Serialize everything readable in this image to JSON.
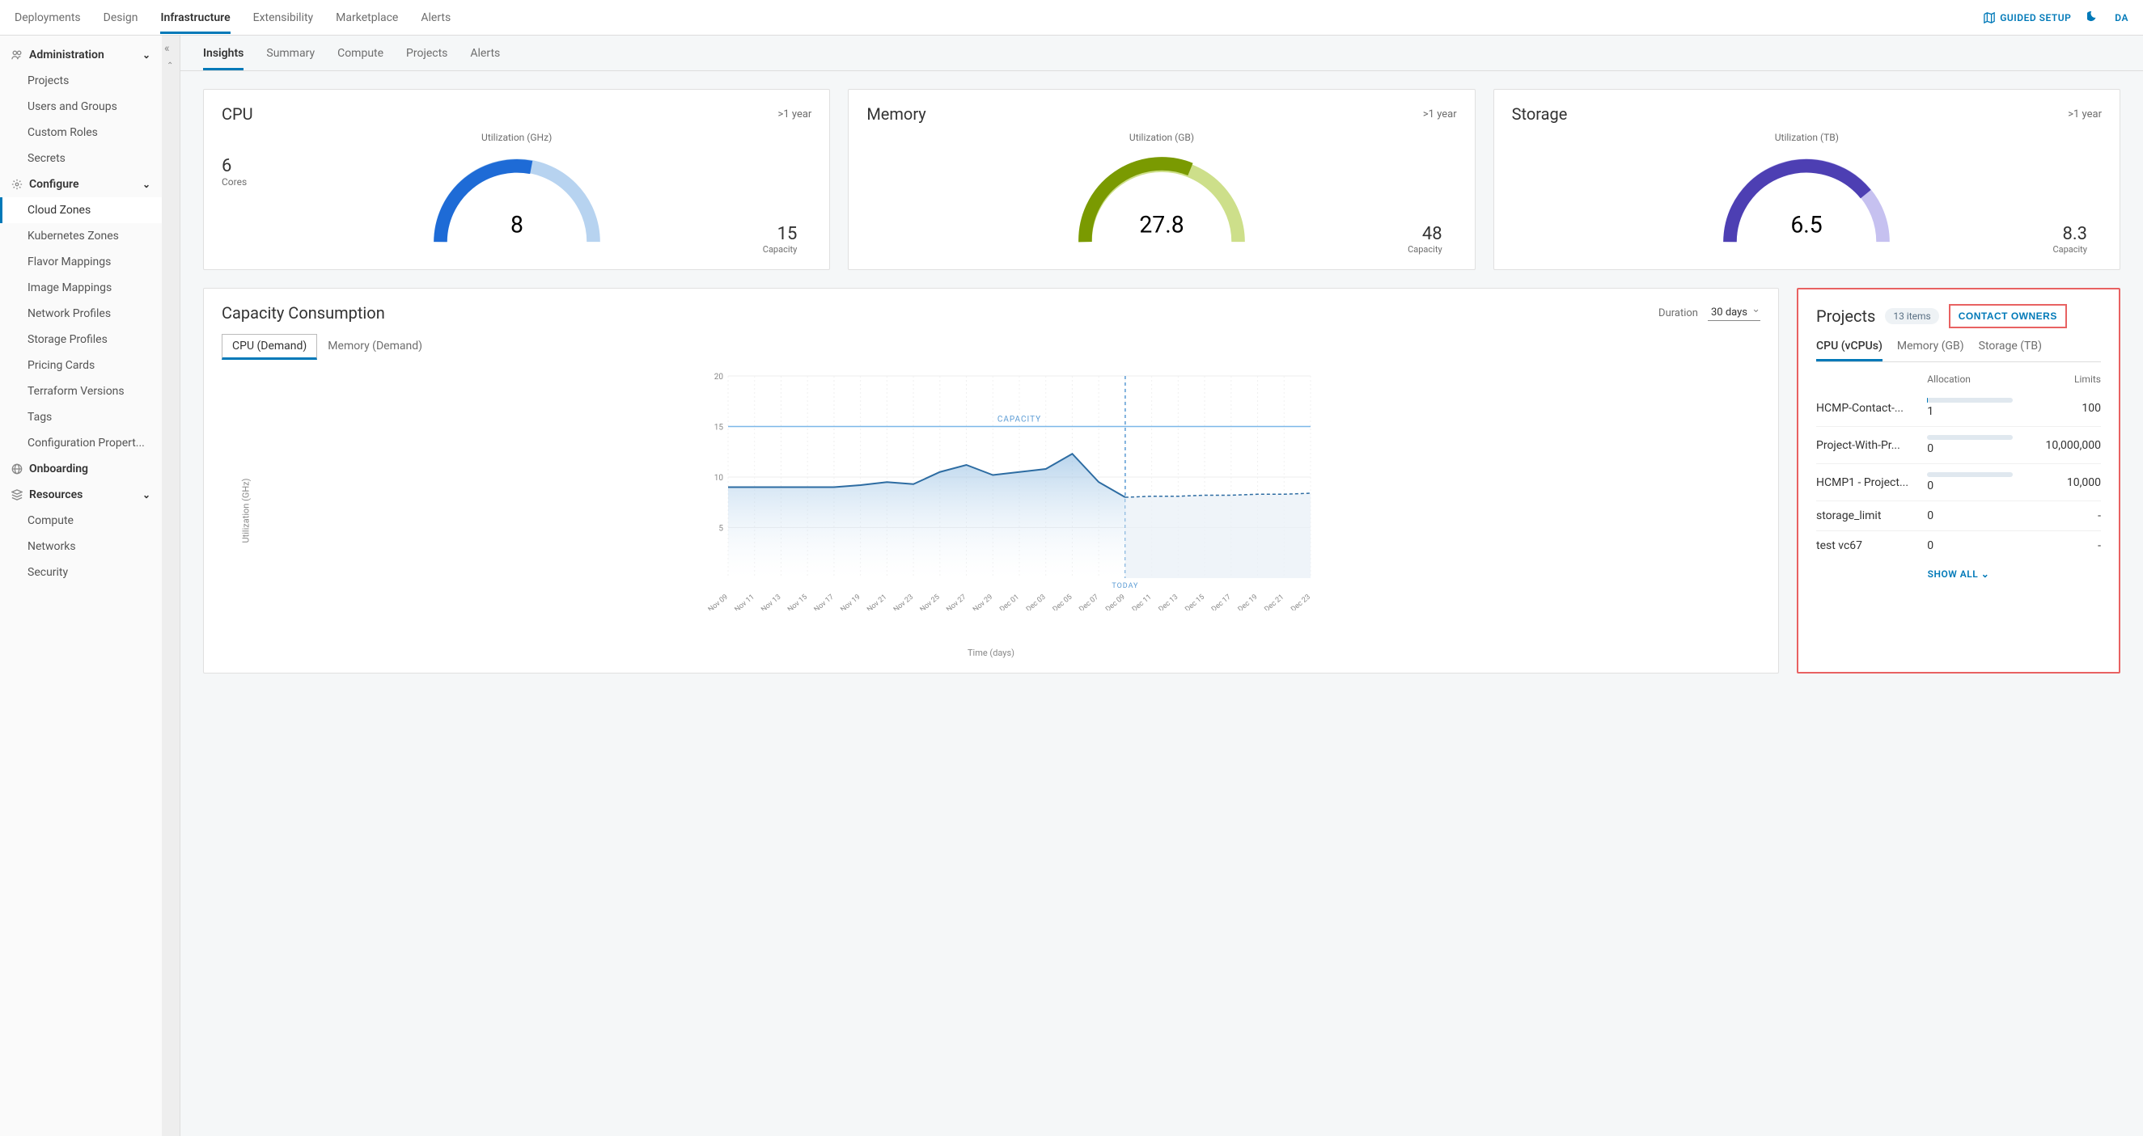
{
  "top_nav": {
    "items": [
      "Deployments",
      "Design",
      "Infrastructure",
      "Extensibility",
      "Marketplace",
      "Alerts"
    ],
    "active": "Infrastructure",
    "guided_setup": "GUIDED SETUP",
    "theme_partial": "DA"
  },
  "sidebar": {
    "groups": [
      {
        "label": "Administration",
        "icon": "users-icon",
        "expanded": true,
        "items": [
          "Projects",
          "Users and Groups",
          "Custom Roles",
          "Secrets"
        ]
      },
      {
        "label": "Configure",
        "icon": "gear-icon",
        "expanded": true,
        "items": [
          "Cloud Zones",
          "Kubernetes Zones",
          "Flavor Mappings",
          "Image Mappings",
          "Network Profiles",
          "Storage Profiles",
          "Pricing Cards",
          "Terraform Versions",
          "Tags",
          "Configuration Propert..."
        ]
      },
      {
        "label": "Onboarding",
        "icon": "globe-icon",
        "expanded": false,
        "items": []
      },
      {
        "label": "Resources",
        "icon": "stack-icon",
        "expanded": true,
        "items": [
          "Compute",
          "Networks",
          "Security"
        ]
      }
    ],
    "active_item": "Cloud Zones"
  },
  "sub_tabs": {
    "items": [
      "Insights",
      "Summary",
      "Compute",
      "Projects",
      "Alerts"
    ],
    "active": "Insights"
  },
  "gauges": [
    {
      "title": "CPU",
      "timeframe": ">1 year",
      "sub": "Utilization (GHz)",
      "value": "8",
      "capacity": "15",
      "cap_label": "Capacity",
      "cores_val": "6",
      "cores_lbl": "Cores",
      "fill_pct": 53,
      "color": "#1e6bd6",
      "track": "#b7d3f0"
    },
    {
      "title": "Memory",
      "timeframe": ">1 year",
      "sub": "Utilization (GB)",
      "value": "27.8",
      "capacity": "48",
      "cap_label": "Capacity",
      "fill_pct": 58,
      "color": "#7a9a01",
      "track": "#cddf8a"
    },
    {
      "title": "Storage",
      "timeframe": ">1 year",
      "sub": "Utilization (TB)",
      "value": "6.5",
      "capacity": "8.3",
      "cap_label": "Capacity",
      "fill_pct": 78,
      "color": "#4d3fb3",
      "track": "#c6c1f0"
    }
  ],
  "chart": {
    "title": "Capacity Consumption",
    "duration_label": "Duration",
    "duration_value": "30 days",
    "tabs": [
      "CPU (Demand)",
      "Memory (Demand)"
    ],
    "active_tab": "CPU (Demand)",
    "ylabel": "Utilization (GHz)",
    "xlabel": "Time (days)",
    "capacity_label": "CAPACITY",
    "today_label": "TODAY"
  },
  "chart_data": {
    "type": "line",
    "categories": [
      "Nov 09",
      "Nov 11",
      "Nov 13",
      "Nov 15",
      "Nov 17",
      "Nov 19",
      "Nov 21",
      "Nov 23",
      "Nov 25",
      "Nov 27",
      "Nov 29",
      "Dec 01",
      "Dec 03",
      "Dec 05",
      "Dec 07",
      "Dec 09",
      "Dec 11",
      "Dec 13",
      "Dec 15",
      "Dec 17",
      "Dec 19",
      "Dec 21",
      "Dec 23"
    ],
    "series": [
      {
        "name": "CPU Demand (historical)",
        "values": [
          9,
          9,
          9,
          9,
          9,
          9.2,
          9.5,
          9.3,
          10.5,
          11.2,
          10.2,
          10.5,
          10.8,
          12.3,
          9.5,
          8.0,
          null,
          null,
          null,
          null,
          null,
          null,
          null
        ]
      },
      {
        "name": "CPU Demand (forecast)",
        "values": [
          null,
          null,
          null,
          null,
          null,
          null,
          null,
          null,
          null,
          null,
          null,
          null,
          null,
          null,
          null,
          8.0,
          8.1,
          8.1,
          8.2,
          8.2,
          8.3,
          8.3,
          8.4
        ]
      }
    ],
    "capacity_line": 15,
    "today_index": 15,
    "ylim": [
      0,
      20
    ],
    "yticks": [
      5,
      10,
      15,
      20
    ],
    "ylabel": "Utilization (GHz)",
    "xlabel": "Time (days)"
  },
  "projects_panel": {
    "title": "Projects",
    "badge": "13 items",
    "contact_btn": "CONTACT OWNERS",
    "tabs": [
      "CPU (vCPUs)",
      "Memory (GB)",
      "Storage (TB)"
    ],
    "active_tab": "CPU (vCPUs)",
    "col_alloc": "Allocation",
    "col_limits": "Limits",
    "rows": [
      {
        "name": "HCMP-Contact-...",
        "alloc": "1",
        "limit": "100",
        "bar_pct": 1
      },
      {
        "name": "Project-With-Pr...",
        "alloc": "0",
        "limit": "10,000,000",
        "bar_pct": 0
      },
      {
        "name": "HCMP1 - Project...",
        "alloc": "0",
        "limit": "10,000",
        "bar_pct": 0
      },
      {
        "name": "storage_limit",
        "alloc": "0",
        "limit": "-",
        "bar_pct": null
      },
      {
        "name": "test vc67",
        "alloc": "0",
        "limit": "-",
        "bar_pct": null
      }
    ],
    "show_all": "SHOW ALL"
  }
}
